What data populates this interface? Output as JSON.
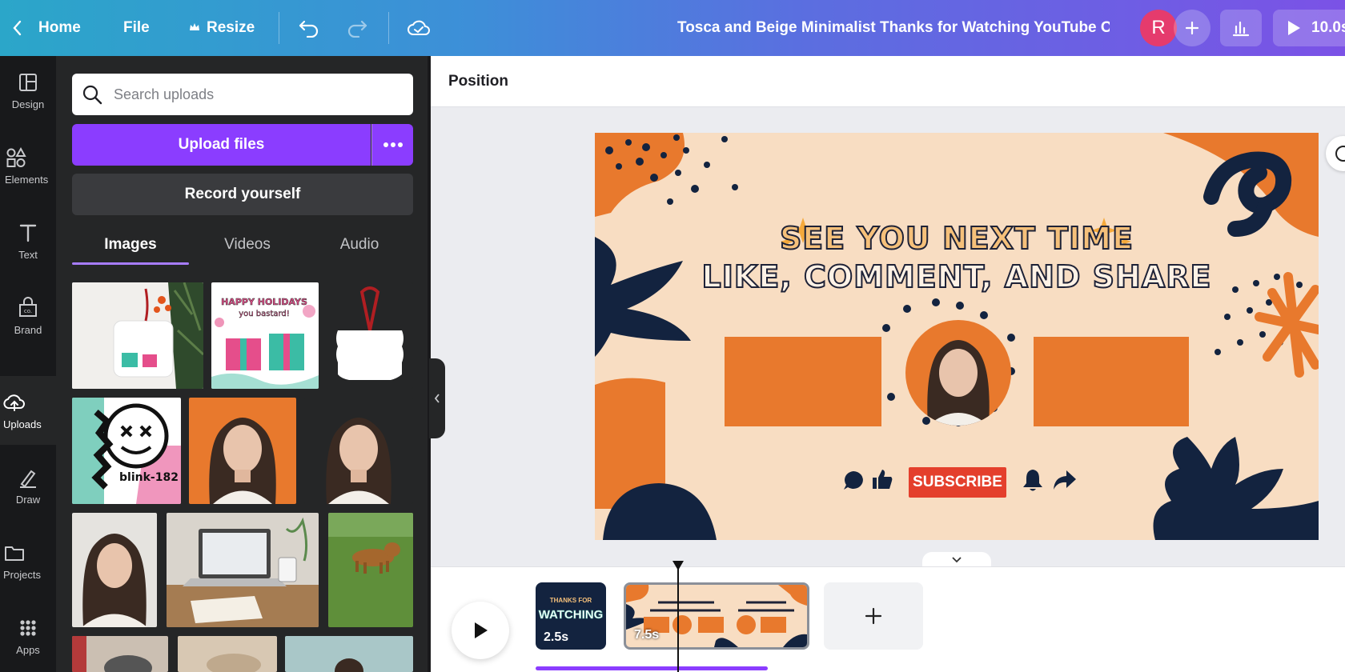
{
  "topbar": {
    "home_label": "Home",
    "file_label": "File",
    "resize_label": "Resize",
    "doc_title": "Tosca and Beige Minimalist Thanks for Watching YouTube O...",
    "avatar_initial": "R",
    "play_duration": "10.0s"
  },
  "rail": {
    "items": [
      {
        "label": "Design",
        "icon": "layout-icon"
      },
      {
        "label": "Elements",
        "icon": "shapes-icon"
      },
      {
        "label": "Text",
        "icon": "text-icon"
      },
      {
        "label": "Brand",
        "icon": "brand-icon"
      },
      {
        "label": "Uploads",
        "icon": "cloud-upload-icon"
      },
      {
        "label": "Draw",
        "icon": "draw-icon"
      },
      {
        "label": "Projects",
        "icon": "folder-icon"
      },
      {
        "label": "Apps",
        "icon": "apps-grid-icon"
      }
    ],
    "active": "Uploads"
  },
  "panel": {
    "search_placeholder": "Search uploads",
    "upload_label": "Upload files",
    "record_label": "Record yourself",
    "tabs": [
      "Images",
      "Videos",
      "Audio"
    ],
    "active_tab": "Images"
  },
  "editor": {
    "subbar_label": "Position"
  },
  "design": {
    "line1": "SEE YOU NEXT TIME",
    "line2": "LIKE, COMMENT, AND SHARE",
    "subscribe": "SUBSCRIBE",
    "colors": {
      "background": "#f8ddc2",
      "orange": "#e8792d",
      "navy": "#13233f",
      "red": "#e43f2c"
    }
  },
  "timeline": {
    "clips": [
      {
        "label": "2.5s",
        "caption_line1": "THANKS FOR",
        "caption_line2": "WATCHING"
      },
      {
        "label": "7.5s"
      }
    ]
  },
  "colors": {
    "accent": "#8b3dff",
    "rail_bg": "#18191b",
    "panel_bg": "#252627"
  }
}
